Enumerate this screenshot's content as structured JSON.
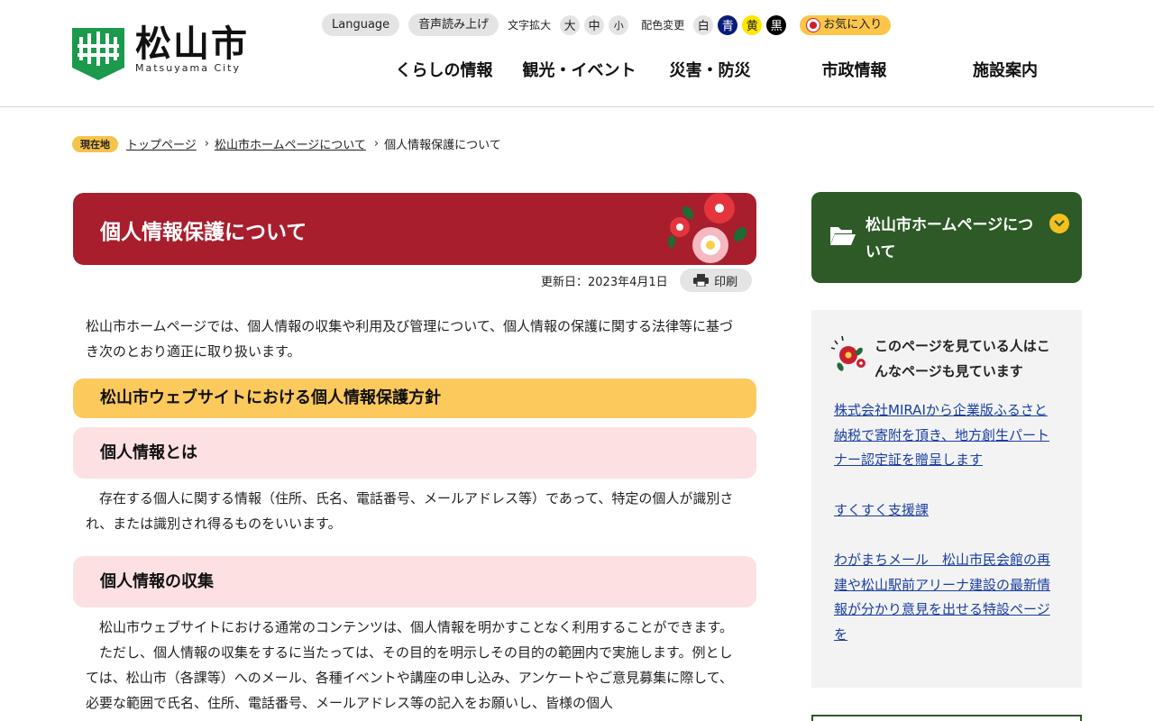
{
  "header": {
    "logo_jp": "松山市",
    "logo_en": "Matsuyama City",
    "language": "Language",
    "read_aloud": "音声読み上げ",
    "text_size_label": "文字拡大",
    "size_large": "大",
    "size_medium": "中",
    "size_small": "小",
    "color_label": "配色変更",
    "color_white": "白",
    "color_blue": "青",
    "color_yellow": "黄",
    "color_black": "黒",
    "favorite": "お気に入り",
    "nav": [
      "くらしの情報",
      "観光・イベント",
      "災害・防災",
      "市政情報",
      "施設案内"
    ]
  },
  "breadcrumb": {
    "here": "現在地",
    "items": [
      "トップページ",
      "松山市ホームページについて",
      "個人情報保護について"
    ]
  },
  "page": {
    "title": "個人情報保護について",
    "updated": "更新日：2023年4月1日",
    "print": "印刷",
    "intro": "松山市ホームページでは、個人情報の収集や利用及び管理について、個人情報の保護に関する法律等に基づき次のとおり適正に取り扱います。",
    "h2": "松山市ウェブサイトにおける個人情報保護方針",
    "sections": [
      {
        "heading": "個人情報とは",
        "body": "　存在する個人に関する情報（住所、氏名、電話番号、メールアドレス等）であって、特定の個人が識別され、または識別され得るものをいいます。"
      },
      {
        "heading": "個人情報の収集",
        "body": "　松山市ウェブサイトにおける通常のコンテンツは、個人情報を明かすことなく利用することができます。",
        "body2": "　ただし、個人情報の収集をするに当たっては、その目的を明示しその目的の範囲内で実施します。例としては、松山市（各課等）へのメール、各種イベントや講座の申し込み、アンケートやご意見募集に際して、必要な範囲で氏名、住所、電話番号、メールアドレス等の記入をお願いし、皆様の個人"
      }
    ]
  },
  "sidebar": {
    "category": "松山市ホームページについて",
    "related_title": "このページを見ている人はこんなページも見ています",
    "links": [
      "株式会社MIRAIから企業版ふるさと納税で寄附を頂き、地方創生パートナー認定証を贈呈します",
      "すくすく支援課",
      "わがまちメール　松山市民会館の再建や松山駅前アリーナ建設の最新情報が分かり意見を出せる特設ページを"
    ]
  },
  "colors": {
    "title_bg": "#a81e2d",
    "h2_bg": "#fcc95c",
    "h3_bg": "#fde0e2",
    "side_head_bg": "#2d5a27",
    "logo_green": "#1a9a4a",
    "link": "#1a3fa0"
  }
}
